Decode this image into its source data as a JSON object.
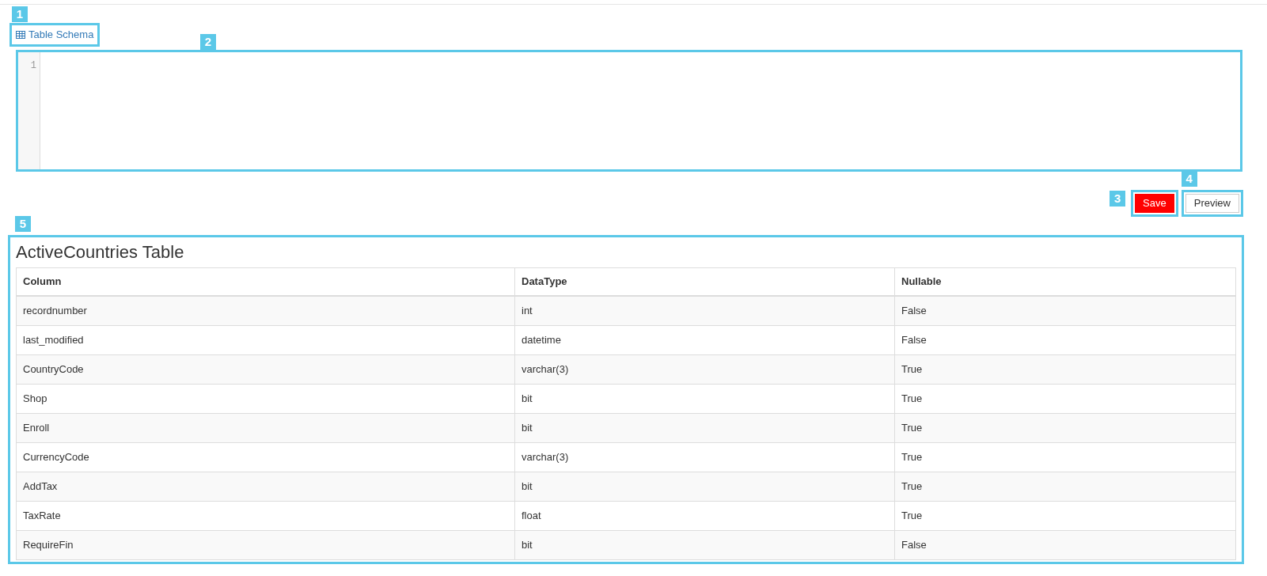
{
  "schema_link": {
    "label": "Table Schema",
    "annotation": "1"
  },
  "editor": {
    "line_numbers": [
      "1"
    ],
    "annotation": "2"
  },
  "buttons": [
    {
      "label": "Save",
      "kind": "primary",
      "annotation": "3"
    },
    {
      "label": "Preview",
      "kind": "default",
      "annotation": "4"
    }
  ],
  "table": {
    "title": "ActiveCountries Table",
    "annotation": "5",
    "columns": [
      "Column",
      "DataType",
      "Nullable"
    ],
    "rows": [
      [
        "recordnumber",
        "int",
        "False"
      ],
      [
        "last_modified",
        "datetime",
        "False"
      ],
      [
        "CountryCode",
        "varchar(3)",
        "True"
      ],
      [
        "Shop",
        "bit",
        "True"
      ],
      [
        "Enroll",
        "bit",
        "True"
      ],
      [
        "CurrencyCode",
        "varchar(3)",
        "True"
      ],
      [
        "AddTax",
        "bit",
        "True"
      ],
      [
        "TaxRate",
        "float",
        "True"
      ],
      [
        "RequireFin",
        "bit",
        "False"
      ]
    ]
  }
}
